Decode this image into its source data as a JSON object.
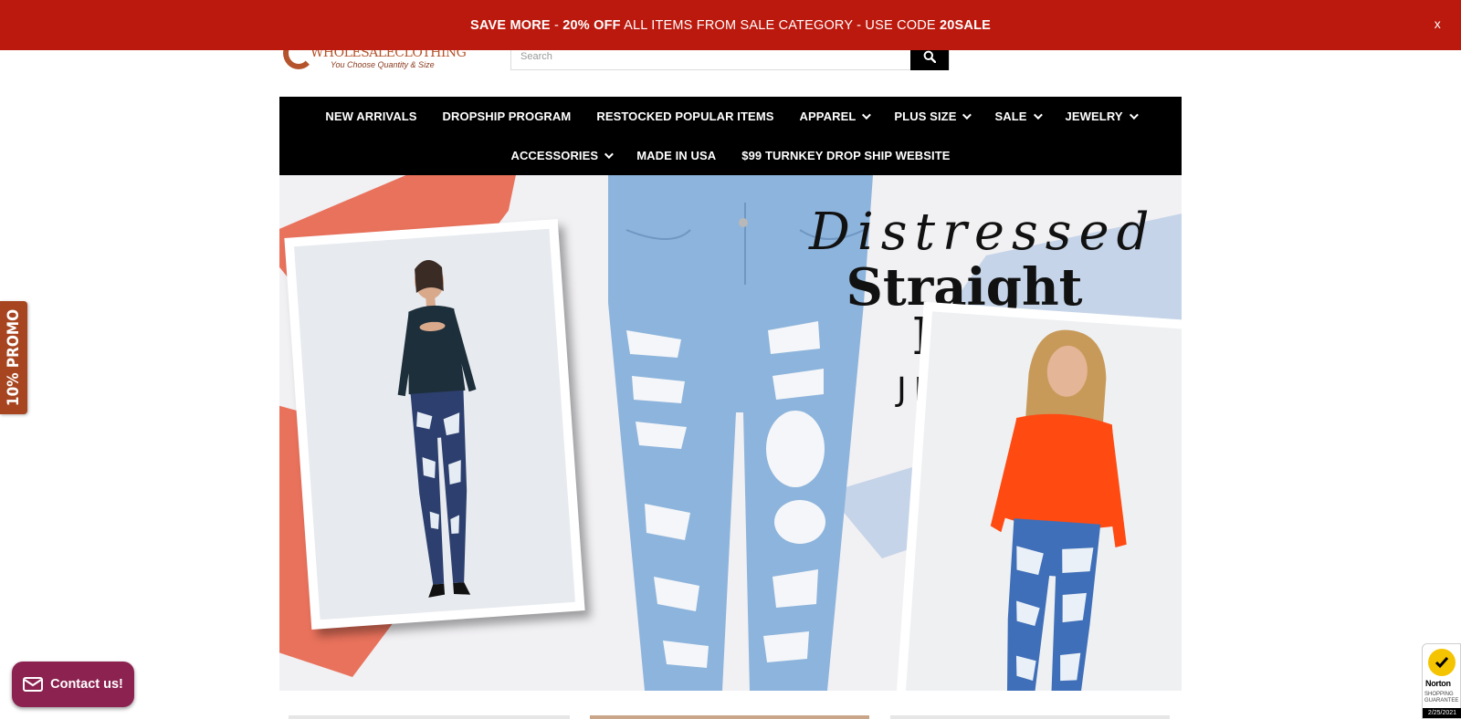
{
  "promo_bar": {
    "part1_bold": "SAVE MORE",
    "part2": " - ",
    "part3_bold": "20% OFF",
    "part4": " ALL ITEMS FROM SALE CATEGORY - USE CODE ",
    "part5_bold": "20SALE",
    "close_label": "x"
  },
  "header": {
    "logo_text": "WHOLESALECLOTHING",
    "logo_tagline": "You Choose Quantity & Size",
    "search_placeholder": "Search"
  },
  "nav": {
    "row1": [
      {
        "label": "NEW ARRIVALS",
        "has_dropdown": false
      },
      {
        "label": "DROPSHIP PROGRAM",
        "has_dropdown": false
      },
      {
        "label": "RESTOCKED POPULAR ITEMS",
        "has_dropdown": false
      },
      {
        "label": "APPAREL",
        "has_dropdown": true
      },
      {
        "label": "PLUS SIZE",
        "has_dropdown": true
      },
      {
        "label": "SALE",
        "has_dropdown": true
      },
      {
        "label": "JEWELRY",
        "has_dropdown": true
      }
    ],
    "row2": [
      {
        "label": "ACCESSORIES",
        "has_dropdown": true
      },
      {
        "label": "MADE IN USA",
        "has_dropdown": false
      },
      {
        "label": "$99 TURNKEY DROP SHIP WEBSITE",
        "has_dropdown": false
      }
    ]
  },
  "hero": {
    "title_script": "Distressed",
    "title_line1": "Straight",
    "title_line2": "Leg",
    "title_sub": "JEANS"
  },
  "side_promo": {
    "label": "10% PROMO"
  },
  "contact": {
    "label": "Contact us!"
  },
  "norton": {
    "name": "Norton",
    "line1": "SHOPPING",
    "line2": "GUARANTEE",
    "date": "2/25/2021"
  },
  "colors": {
    "promo_bar": "#bb190d",
    "nav_bg": "#000000",
    "promo_tab": "#a64520",
    "contact_btn": "#8b2250",
    "brush_coral": "#e9725c",
    "brush_blue": "#c5d4e8"
  }
}
